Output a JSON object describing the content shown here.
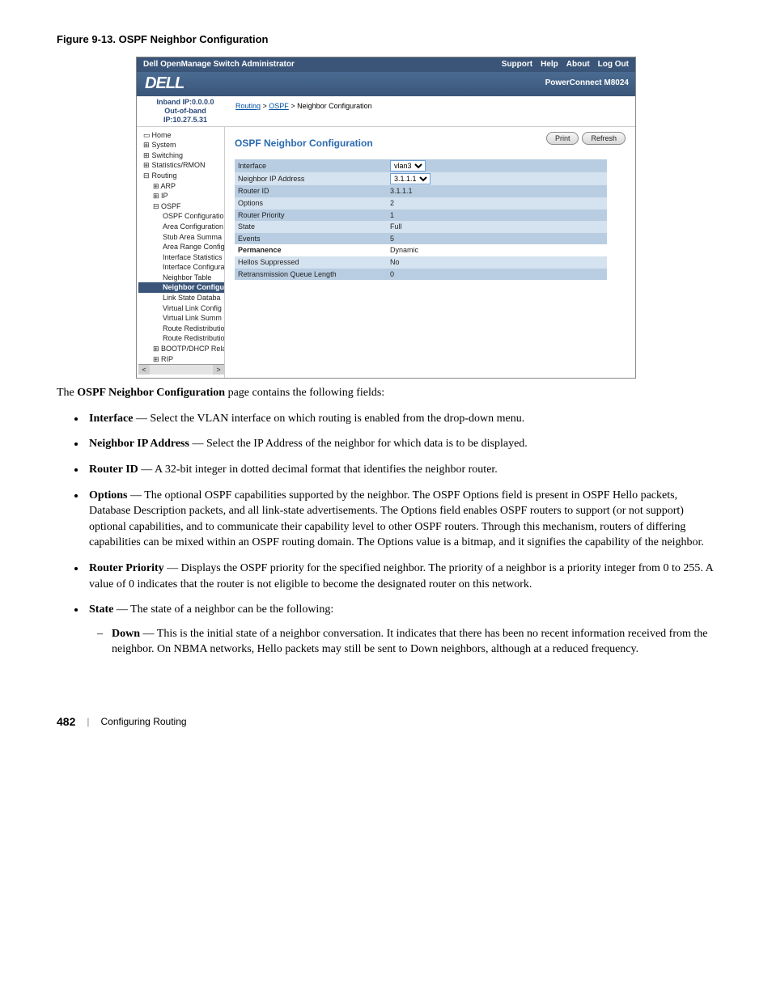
{
  "figure_caption": "Figure 9-13.    OSPF Neighbor Configuration",
  "top_bar": {
    "title": "Dell OpenManage Switch Administrator",
    "links": [
      "Support",
      "Help",
      "About",
      "Log Out"
    ]
  },
  "logo": "DELL",
  "product": "PowerConnect M8024",
  "ip_info": {
    "inband": "Inband IP:0.0.0.0",
    "oob": "Out-of-band IP:10.27.5.31"
  },
  "breadcrumb": {
    "a": "Routing",
    "b": "OSPF",
    "c": "Neighbor Configuration"
  },
  "nav": {
    "home": "Home",
    "system": "System",
    "switching": "Switching",
    "stats": "Statistics/RMON",
    "routing": "Routing",
    "arp": "ARP",
    "ip": "IP",
    "ospf": "OSPF",
    "ospf_items": [
      "OSPF Configuratio",
      "Area Configuration",
      "Stub Area Summa",
      "Area Range Config",
      "Interface Statistics",
      "Interface Configura",
      "Neighbor Table",
      "Neighbor Configu",
      "Link State Databa",
      "Virtual Link Config",
      "Virtual Link Summ",
      "Route Redistributio",
      "Route Redistributio"
    ],
    "bootp": "BOOTP/DHCP Relay",
    "rip": "RIP"
  },
  "page_title": "OSPF Neighbor Configuration",
  "buttons": {
    "print": "Print",
    "refresh": "Refresh"
  },
  "form": {
    "rows": [
      {
        "label": "Interface",
        "value": "vlan3",
        "type": "select"
      },
      {
        "label": "Neighbor IP Address",
        "value": "3.1.1.1",
        "type": "select"
      },
      {
        "label": "Router ID",
        "value": "3.1.1.1"
      },
      {
        "label": "Options",
        "value": "2"
      },
      {
        "label": "Router Priority",
        "value": "1"
      },
      {
        "label": "State",
        "value": "Full"
      },
      {
        "label": "Events",
        "value": "5"
      },
      {
        "label": "Permanence",
        "value": "Dynamic",
        "bold": true
      },
      {
        "label": "Hellos Suppressed",
        "value": "No"
      },
      {
        "label": "Retransmission Queue Length",
        "value": "0"
      }
    ]
  },
  "body": {
    "intro_a": "The ",
    "intro_b": "OSPF Neighbor Configuration",
    "intro_c": " page contains the following fields:",
    "bullets": [
      {
        "term": "Interface",
        "text": " — Select the VLAN interface on which routing is enabled from the drop-down menu."
      },
      {
        "term": "Neighbor IP Address",
        "text": " — Select the IP Address of the neighbor for which data is to be displayed."
      },
      {
        "term": "Router ID",
        "text": " — A 32-bit integer in dotted decimal format that identifies the neighbor router."
      },
      {
        "term": "Options",
        "text": " — The optional OSPF capabilities supported by the neighbor. The OSPF Options field is present in OSPF Hello packets, Database Description packets, and all link-state advertisements. The Options field enables OSPF routers to support (or not support) optional capabilities, and to communicate their capability level to other OSPF routers. Through this mechanism, routers of differing capabilities can be mixed within an OSPF routing domain. The Options value is a bitmap, and it signifies the capability of the neighbor."
      },
      {
        "term": "Router Priority",
        "text": " — Displays the OSPF priority for the specified neighbor. The priority of a neighbor is a priority integer from 0 to 255. A value of 0 indicates that the router is not eligible to become the designated router on this network."
      },
      {
        "term": "State",
        "text": " — The state of a neighbor can be the following:",
        "sub": [
          {
            "term": "Down",
            "text": " — This is the initial state of a neighbor conversation. It indicates that there has been no recent information received from the neighbor. On NBMA networks, Hello packets may still be sent to Down neighbors, although at a reduced frequency."
          }
        ]
      }
    ]
  },
  "footer": {
    "page": "482",
    "section": "Configuring Routing"
  }
}
